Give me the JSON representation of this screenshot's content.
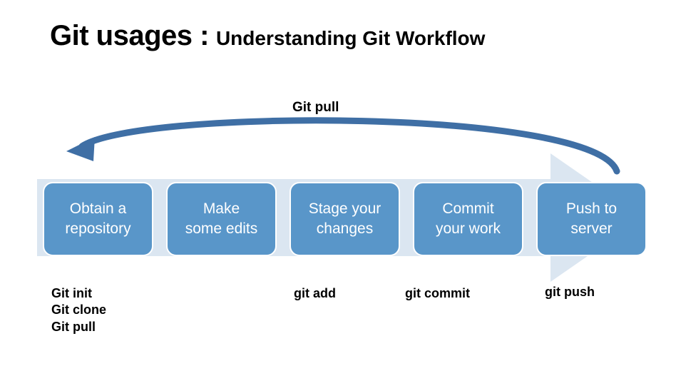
{
  "title": {
    "main": "Git usages :",
    "sub": "Understanding Git Workflow"
  },
  "pull_label": "Git pull",
  "steps": [
    {
      "line1": "Obtain a",
      "line2": "repository"
    },
    {
      "line1": "Make",
      "line2": "some edits"
    },
    {
      "line1": "Stage your",
      "line2": "changes"
    },
    {
      "line1": "Commit",
      "line2": "your work"
    },
    {
      "line1": "Push to",
      "line2": "server"
    }
  ],
  "commands": {
    "obtain": "Git init\nGit clone\nGit pull",
    "add": "git add",
    "commit": "git commit",
    "push": "git push"
  },
  "colors": {
    "box_fill": "#5996c9",
    "bg_arrow": "#dbe6f1",
    "curve": "#3f6fa5"
  }
}
